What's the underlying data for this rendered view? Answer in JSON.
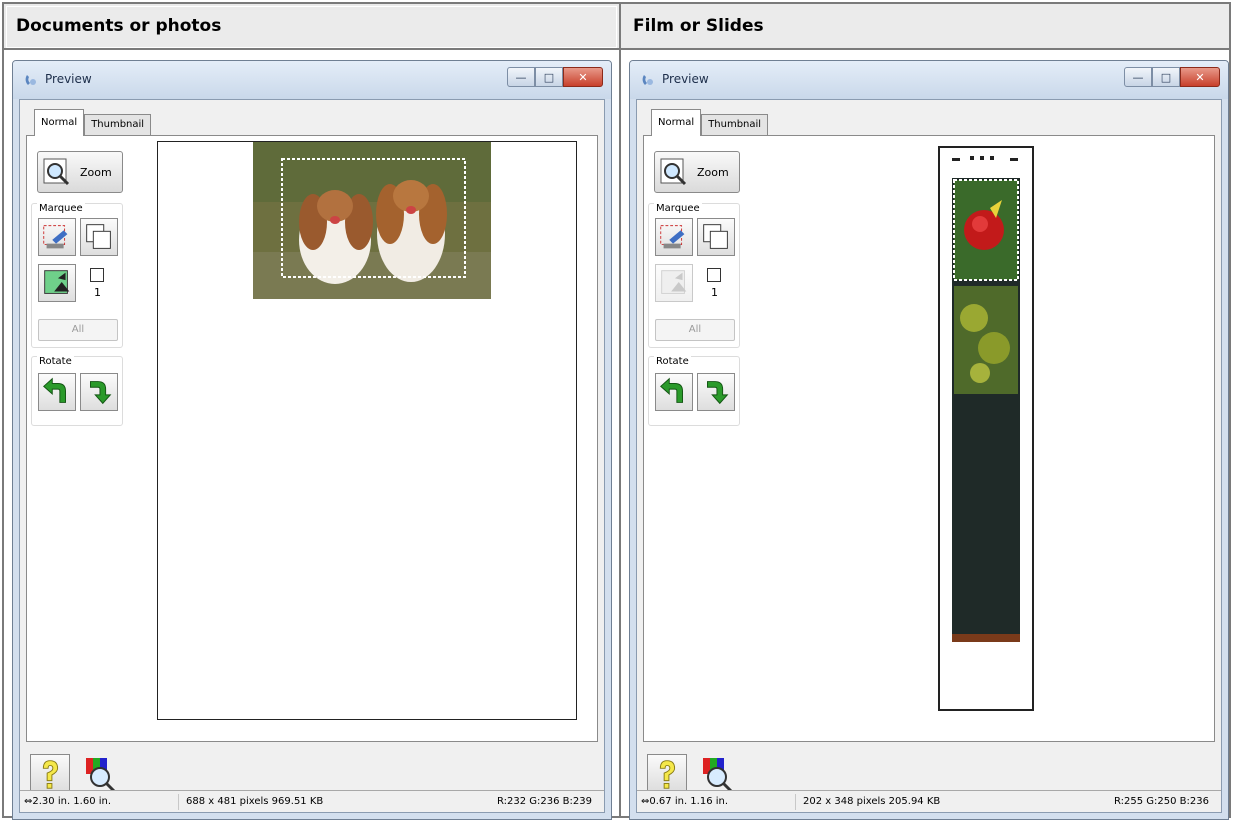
{
  "panels": [
    {
      "header": "Documents or photos",
      "window_title": "Preview",
      "tabs": [
        "Normal",
        "Thumbnail"
      ],
      "zoom_label": "Zoom",
      "marquee_label": "Marquee",
      "marquee_count": "1",
      "all_label": "All",
      "rotate_label": "Rotate",
      "status": {
        "dimensions": "2.30 in.  1.60 in.",
        "pixels": "688 x 481 pixels 969.51 KB",
        "color": "R:232 G:236 B:239"
      }
    },
    {
      "header": "Film or Slides",
      "window_title": "Preview",
      "tabs": [
        "Normal",
        "Thumbnail"
      ],
      "zoom_label": "Zoom",
      "marquee_label": "Marquee",
      "marquee_count": "1",
      "all_label": "All",
      "rotate_label": "Rotate",
      "status": {
        "dimensions": "0.67 in.  1.16 in.",
        "pixels": "202 x 348 pixels 205.94 KB",
        "color": "R:255 G:250 B:236"
      }
    }
  ],
  "icons": [
    "preview-app-icon",
    "zoom-magnifier-icon",
    "marquee-create-icon",
    "marquee-duplicate-icon",
    "auto-locate-icon",
    "rotate-left-icon",
    "rotate-right-icon",
    "help-icon",
    "color-palette-icon",
    "horizontal-arrow-icon",
    "vertical-arrow-icon"
  ],
  "colors": {
    "accent_green": "#2a9a2a",
    "title_bar": "#c9d8ea",
    "close_red": "#c8402b"
  }
}
